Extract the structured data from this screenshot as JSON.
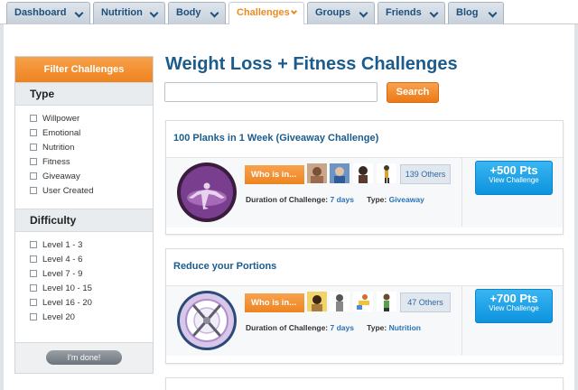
{
  "nav": {
    "tabs": [
      {
        "label": "Dashboard"
      },
      {
        "label": "Nutrition"
      },
      {
        "label": "Body"
      },
      {
        "label": "Challenges",
        "active": true
      },
      {
        "label": "Groups"
      },
      {
        "label": "Friends"
      },
      {
        "label": "Blog"
      }
    ]
  },
  "sidebar": {
    "header": "Filter Challenges",
    "type_heading": "Type",
    "types": [
      "Willpower",
      "Emotional",
      "Nutrition",
      "Fitness",
      "Giveaway",
      "User Created"
    ],
    "difficulty_heading": "Difficulty",
    "levels": [
      "Level 1 - 3",
      "Level 4 - 6",
      "Level 7 - 9",
      "Level 10 - 15",
      "Level 16 - 20",
      "Level 20"
    ],
    "done_label": "I'm done!"
  },
  "page": {
    "title": "Weight Loss + Fitness Challenges",
    "search_value": "",
    "search_button": "Search"
  },
  "challenges": [
    {
      "title": "100 Planks in 1 Week (Giveaway Challenge)",
      "who_label": "Who is in...",
      "others": "139 Others",
      "duration_label": "Duration of Challenge:",
      "duration": "7 days",
      "type_label": "Type:",
      "type": "Giveaway",
      "points": "+500 Pts",
      "view_label": "View Challenge",
      "badge_icon": "plank-figure-badge"
    },
    {
      "title": "Reduce your Portions",
      "who_label": "Who is in...",
      "others": "47 Others",
      "duration_label": "Duration of Challenge:",
      "duration": "7 days",
      "type_label": "Type:",
      "type": "Nutrition",
      "points": "+700 Pts",
      "view_label": "View Challenge",
      "badge_icon": "plate-fork-knife-badge"
    }
  ],
  "colors": {
    "brand_blue": "#1b5c8c",
    "accent_orange": "#ee8420",
    "points_blue": "#0d93dd"
  }
}
